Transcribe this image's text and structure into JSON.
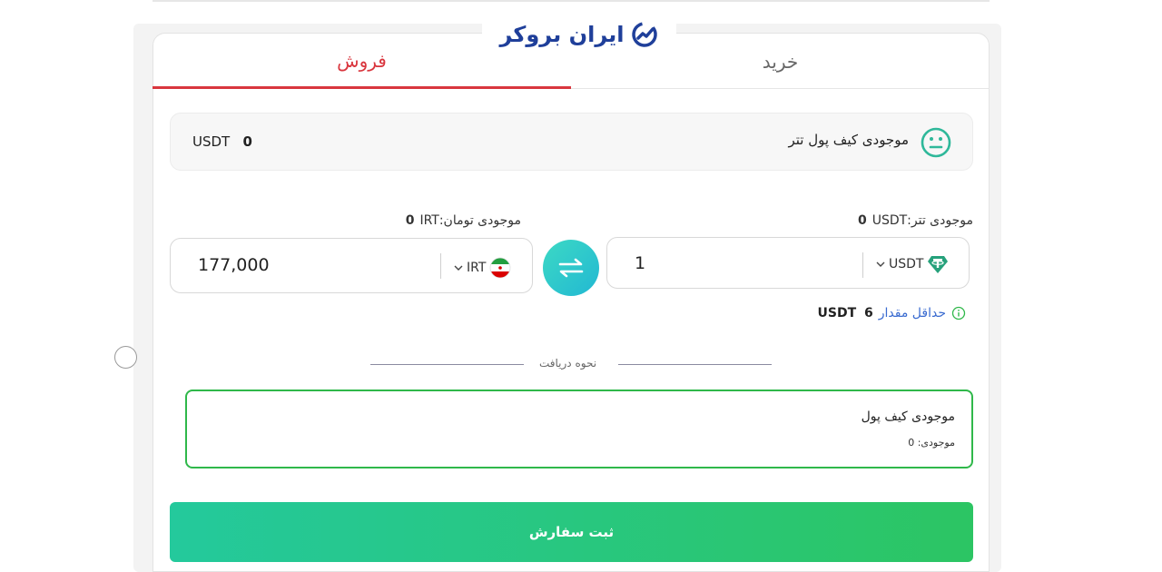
{
  "brand": {
    "name": "ایران بروکر"
  },
  "tabs": {
    "sell": "فروش",
    "buy": "خرید"
  },
  "wallet": {
    "label": "موجودی کیف پول تتر",
    "amount": "0",
    "currency": "USDT"
  },
  "tether_balance": {
    "label": "موجودی تتر:",
    "amount": "0",
    "currency": "USDT"
  },
  "toman_balance": {
    "label": "موجودی تومان:",
    "amount": "0",
    "currency": "IRT"
  },
  "from_field": {
    "value": "1",
    "currency": "USDT"
  },
  "to_field": {
    "value": "177,000",
    "currency": "IRT"
  },
  "minimum": {
    "label": "حداقل مقدار",
    "amount": "6",
    "currency": "USDT"
  },
  "receive": {
    "section_label": "نحوه دریافت",
    "method_title": "موجودی کیف پول",
    "method_balance": "موجودی: 0"
  },
  "submit_label": "ثبت سفارش",
  "colors": {
    "sell": "#d9363e",
    "accent": "#24c99c",
    "selected_border": "#2fb84a",
    "brand": "#1f3f9a"
  },
  "icons": [
    "neutral-face-icon",
    "tether-icon",
    "iran-flag-icon",
    "swap-arrows-icon",
    "info-icon",
    "chevron-down-icon",
    "logo-chart-icon"
  ]
}
